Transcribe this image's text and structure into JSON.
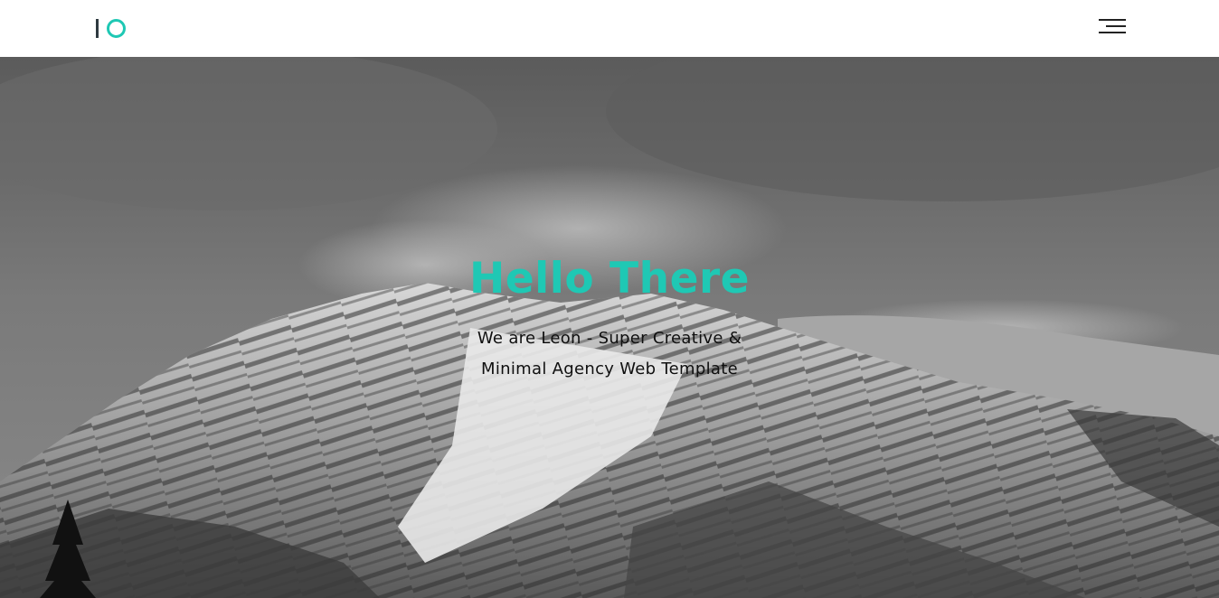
{
  "header": {
    "logo": {
      "text": "IO",
      "bar_color": "#2e3a40",
      "ring_color": "#1fc8b4"
    },
    "menu_icon": "hamburger-menu-icon"
  },
  "hero": {
    "title": "Hello There",
    "subtitle_line1": "We are Leon - Super Creative &",
    "subtitle_line2": "Minimal Agency Web Template",
    "title_color": "#1fc8b4",
    "background": "black-and-white snowy mountain peak under cloudy sky"
  }
}
